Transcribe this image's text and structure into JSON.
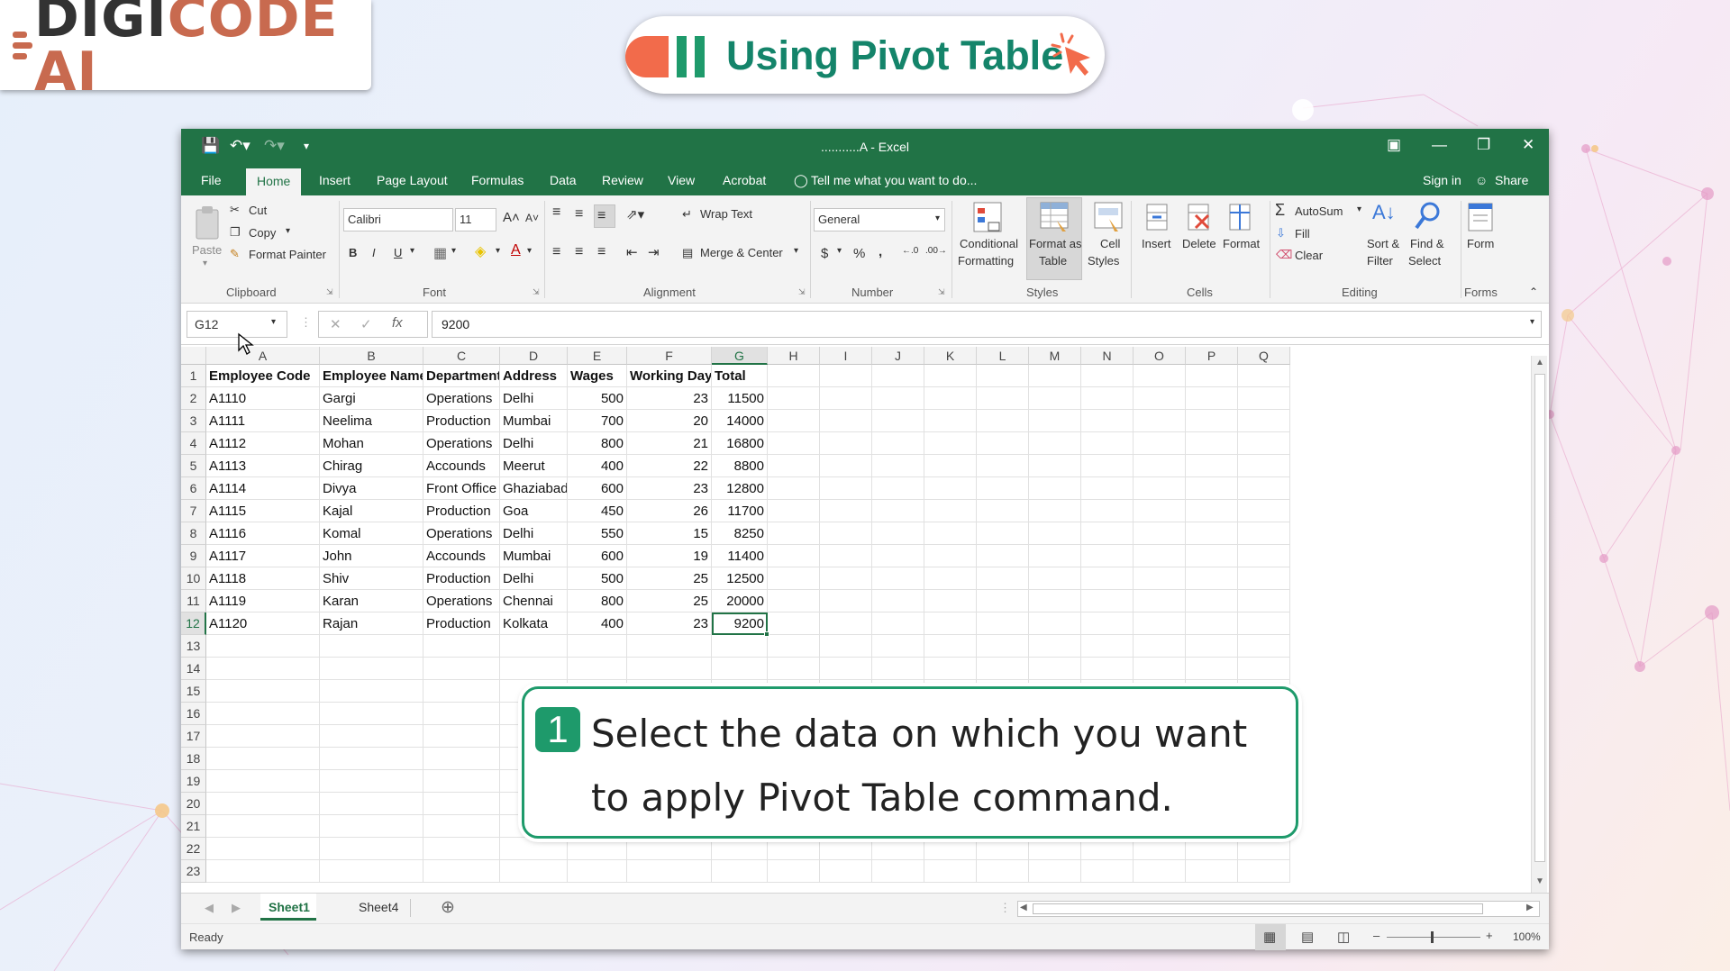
{
  "brand": {
    "logo_main": "DIGI",
    "logo_accent": "CODE AI"
  },
  "title": "Using Pivot Table",
  "excel": {
    "window_title": "...........A  -  Excel",
    "tabs": [
      "File",
      "Home",
      "Insert",
      "Page Layout",
      "Formulas",
      "Data",
      "Review",
      "View",
      "Acrobat"
    ],
    "active_tab": "Home",
    "tell_me": "Tell me what you want to do...",
    "sign_in": "Sign in",
    "share": "Share",
    "ribbon": {
      "clipboard": {
        "paste": "Paste",
        "cut": "Cut",
        "copy": "Copy",
        "format_painter": "Format Painter",
        "group": "Clipboard"
      },
      "font": {
        "name": "Calibri",
        "size": "11",
        "bold": "B",
        "italic": "I",
        "underline": "U",
        "group": "Font"
      },
      "alignment": {
        "wrap_text": "Wrap Text",
        "merge_center": "Merge & Center",
        "group": "Alignment"
      },
      "number": {
        "format": "General",
        "currency": "$",
        "percent": "%",
        "comma": ",",
        "group": "Number"
      },
      "styles": {
        "conditional_1": "Conditional",
        "conditional_2": "Formatting",
        "format_as_1": "Format as",
        "format_as_2": "Table",
        "cell_styles_1": "Cell",
        "cell_styles_2": "Styles",
        "group": "Styles"
      },
      "cells": {
        "insert": "Insert",
        "delete": "Delete",
        "format": "Format",
        "group": "Cells"
      },
      "editing": {
        "autosum": "AutoSum",
        "fill": "Fill",
        "clear": "Clear",
        "sort_1": "Sort &",
        "sort_2": "Filter",
        "find_1": "Find &",
        "find_2": "Select",
        "group": "Editing"
      },
      "forms": {
        "form": "Form",
        "group": "Forms"
      }
    },
    "name_box": "G12",
    "formula": "9200",
    "columns": [
      "A",
      "B",
      "C",
      "D",
      "E",
      "F",
      "G",
      "H",
      "I",
      "J",
      "K",
      "L",
      "M",
      "N",
      "O",
      "P",
      "Q"
    ],
    "selected_column": "G",
    "row_numbers": [
      "1",
      "2",
      "3",
      "4",
      "5",
      "6",
      "7",
      "8",
      "9",
      "10",
      "11",
      "12",
      "13",
      "14",
      "15",
      "16",
      "17",
      "18",
      "19",
      "20",
      "21",
      "22",
      "23"
    ],
    "selected_row": "12",
    "table": {
      "headers": [
        "Employee Code",
        "Employee Name",
        "Department",
        "Address",
        "Wages",
        "Working Days",
        "Total"
      ],
      "rows": [
        [
          "A1110",
          "Gargi",
          "Operations",
          "Delhi",
          "500",
          "23",
          "11500"
        ],
        [
          "A1111",
          "Neelima",
          "Production",
          "Mumbai",
          "700",
          "20",
          "14000"
        ],
        [
          "A1112",
          "Mohan",
          "Operations",
          "Delhi",
          "800",
          "21",
          "16800"
        ],
        [
          "A1113",
          "Chirag",
          "Accounds",
          "Meerut",
          "400",
          "22",
          "8800"
        ],
        [
          "A1114",
          "Divya",
          "Front Office",
          "Ghaziabad",
          "600",
          "23",
          "12800"
        ],
        [
          "A1115",
          "Kajal",
          "Production",
          "Goa",
          "450",
          "26",
          "11700"
        ],
        [
          "A1116",
          "Komal",
          "Operations",
          "Delhi",
          "550",
          "15",
          "8250"
        ],
        [
          "A1117",
          "John",
          "Accounds",
          "Mumbai",
          "600",
          "19",
          "11400"
        ],
        [
          "A1118",
          "Shiv",
          "Production",
          "Delhi",
          "500",
          "25",
          "12500"
        ],
        [
          "A1119",
          "Karan",
          "Operations",
          "Chennai",
          "800",
          "25",
          "20000"
        ],
        [
          "A1120",
          "Rajan",
          "Production",
          "Kolkata",
          "400",
          "23",
          "9200"
        ]
      ]
    },
    "sheets": [
      "Sheet1",
      "Sheet4"
    ],
    "active_sheet": "Sheet1",
    "status": "Ready",
    "zoom": "100%",
    "accent_color": "#217346"
  },
  "callout": {
    "step": "1",
    "text": "Select the data on which you want to apply Pivot Table command."
  }
}
